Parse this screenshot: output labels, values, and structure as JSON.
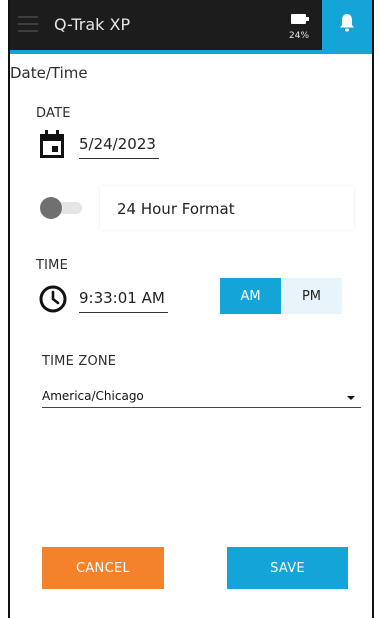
{
  "app": {
    "title": "Q-Trak XP",
    "battery": "24%",
    "colors": {
      "accent": "#13a4d8",
      "cancel": "#f4822b",
      "topbar": "#1c1c1c"
    },
    "icons": {
      "menu": "menu-icon",
      "battery": "battery-icon",
      "notifications": "bell-icon"
    }
  },
  "page": {
    "title": "Date/Time"
  },
  "date": {
    "label": "DATE",
    "value": "5/24/2023",
    "icon": "calendar-icon"
  },
  "format": {
    "label": "24 Hour Format",
    "enabled": false
  },
  "time": {
    "label": "TIME",
    "value": "9:33:01 AM",
    "icon": "clock-icon",
    "am_label": "AM",
    "pm_label": "PM",
    "selected": "AM"
  },
  "timezone": {
    "label": "TIME ZONE",
    "value": "America/Chicago"
  },
  "actions": {
    "cancel_label": "CANCEL",
    "save_label": "SAVE"
  }
}
